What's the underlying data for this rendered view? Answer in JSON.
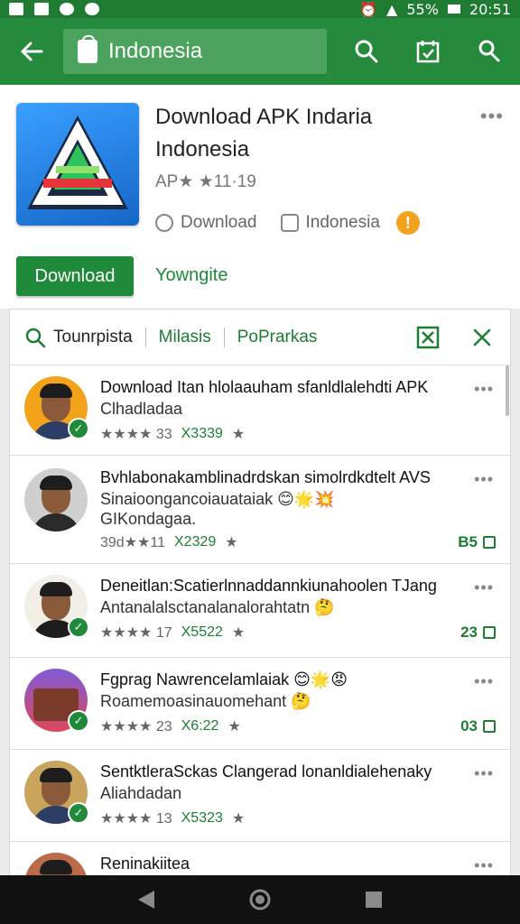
{
  "status_bar": {
    "battery": "55%",
    "time": "20:51"
  },
  "app_bar": {
    "search_value": "Indonesia"
  },
  "app": {
    "title_line1": "Download APK Indaria",
    "title_line2": "Indonesia",
    "rating": "AP★ ★11·19",
    "meta_download": "Download",
    "meta_region": "Indonesia",
    "warning": "!",
    "more": "•••",
    "download_button": "Download",
    "secondary_link": "Yowngite"
  },
  "filters": {
    "search_label": "Tounrpista",
    "tab1": "Milasis",
    "tab2": "PoPrarkas"
  },
  "items": [
    {
      "title": "Download Itan hlolaauham sfanldlalehdti APK",
      "line2": "Clhadladaa",
      "line3": "",
      "stars": "★★★★ 33",
      "count_green": "X3339",
      "extra": "★",
      "right": ""
    },
    {
      "title": "Bvhlabonakamblinadrdskan simolrdkdtelt AVS",
      "line2": "Sinaioongancoiauataiak 😊🌟💥",
      "line3": "GIKondagaa.",
      "stars": "39d★★11",
      "count_green": "X2329",
      "extra": "★",
      "right": "B5"
    },
    {
      "title": "Deneitlan:Scatierlnnaddannkiunahoolen TJang",
      "line2": "Antanalalsctanalanalorahtatn 🤔",
      "line3": "",
      "stars": "★★★★ 17",
      "count_green": "X5522",
      "extra": "★",
      "right": "23"
    },
    {
      "title": "Fgprag Nawrencelamlaiak 😊🌟😡",
      "line2": "Roamemoasinauomehant 🤔",
      "line3": "",
      "stars": "★★★★ 23",
      "count_green": "X6:22",
      "extra": "★",
      "right": "03"
    },
    {
      "title": "SentktleraSckas Clangerad lonanldialehenaky",
      "line2": "Aliahdadan",
      "line3": "",
      "stars": "★★★★ 13",
      "count_green": "X5323",
      "extra": "★",
      "right": ""
    },
    {
      "title": "Reninakiitea",
      "line2": "",
      "line3": "",
      "stars": "",
      "count_green": "",
      "extra": "",
      "right": ""
    }
  ],
  "colors": {
    "primary": "#268a3c",
    "primary_dark": "#1f7a32",
    "accent_warn": "#f4a21d"
  }
}
